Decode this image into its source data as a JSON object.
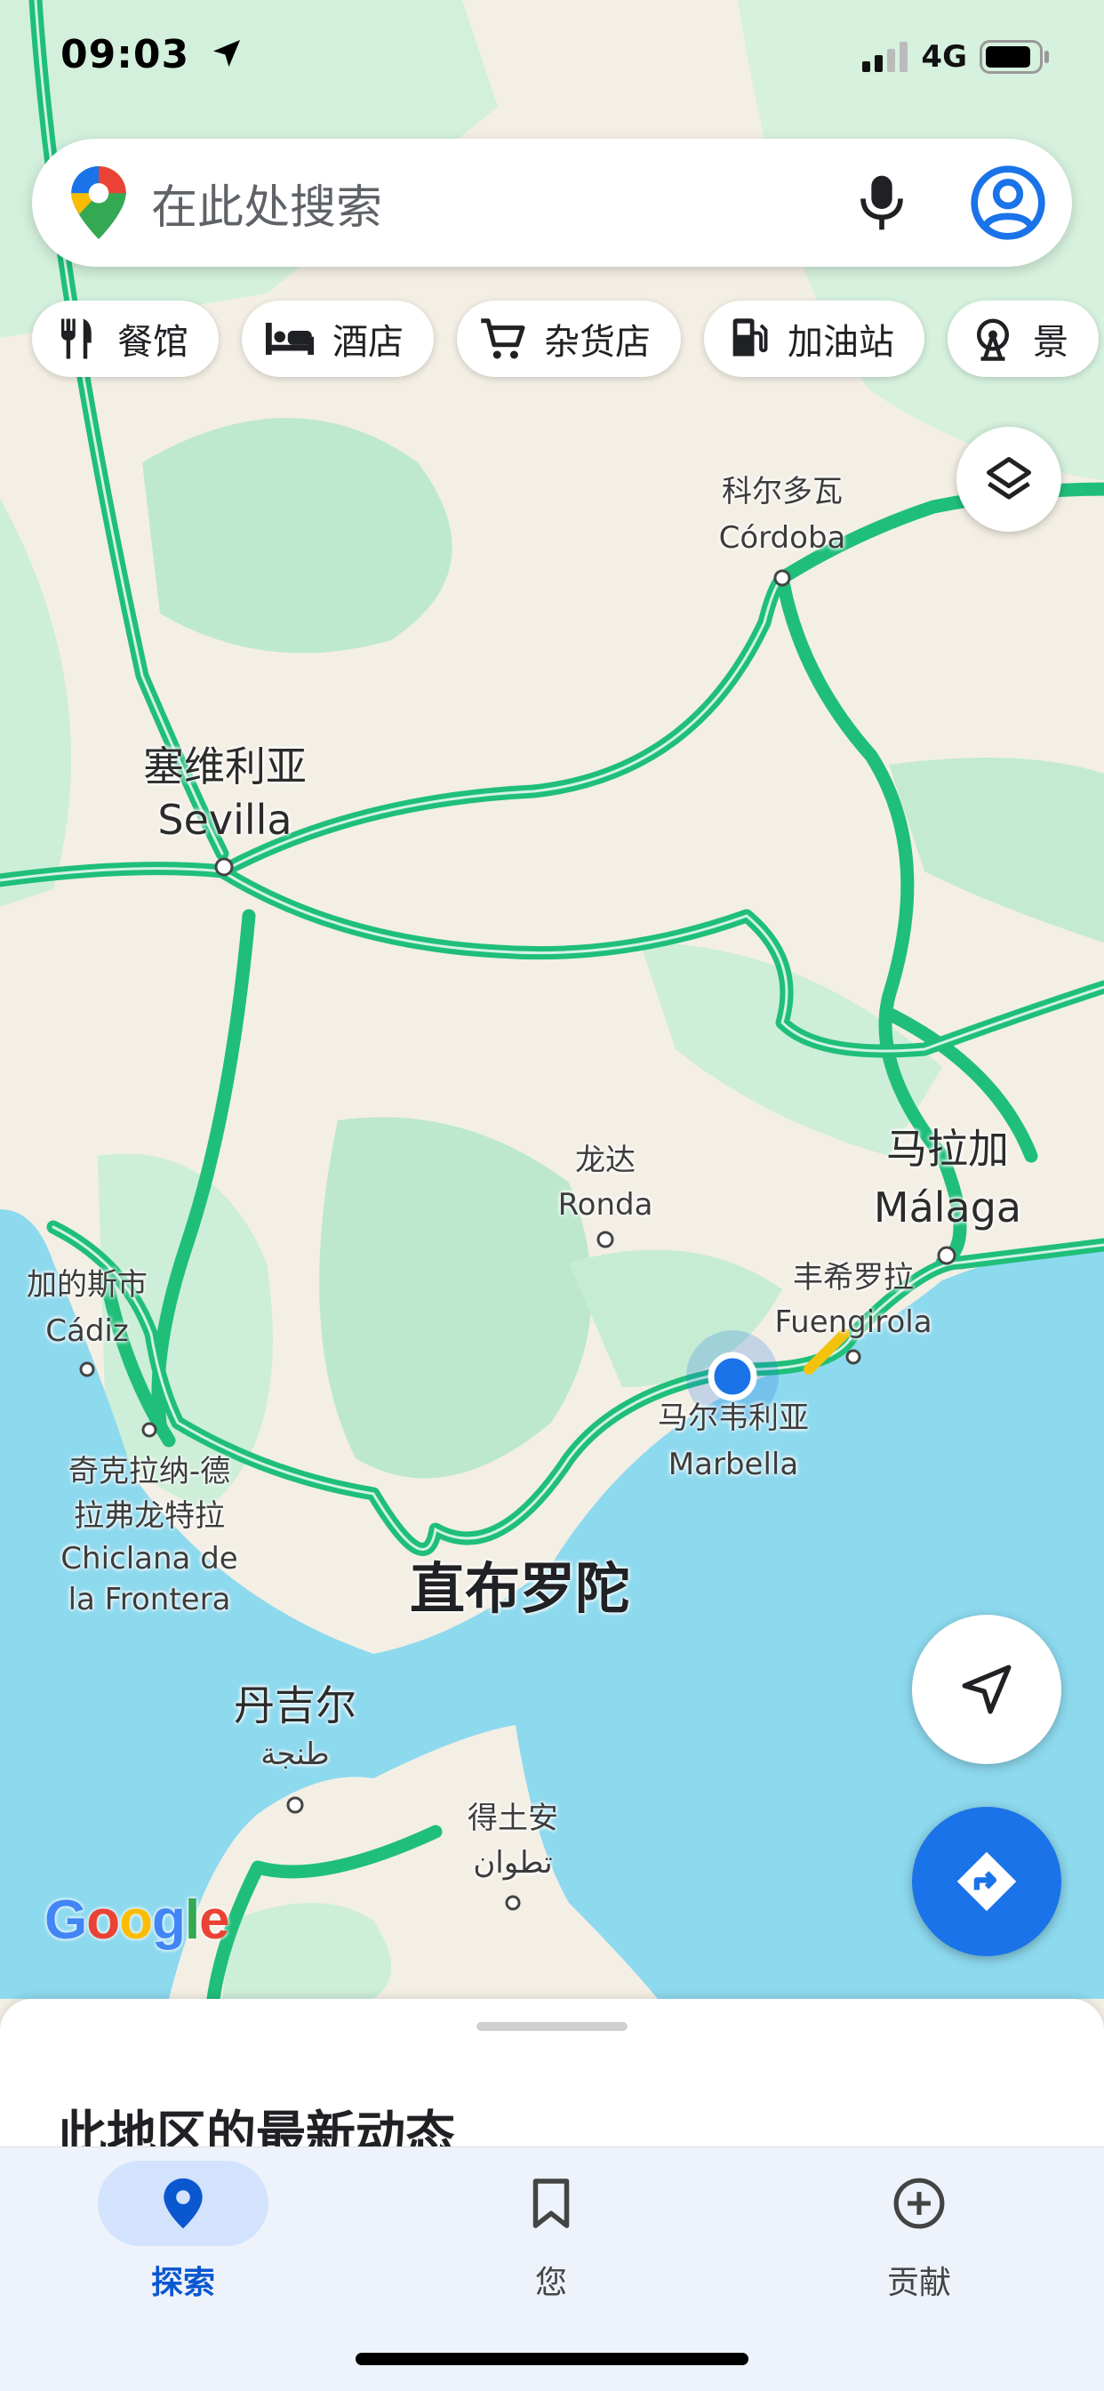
{
  "status_bar": {
    "time": "09:03",
    "network": "4G"
  },
  "search": {
    "placeholder": "在此处搜索"
  },
  "chips": [
    {
      "label": "餐馆",
      "icon": "restaurant-icon"
    },
    {
      "label": "酒店",
      "icon": "hotel-icon"
    },
    {
      "label": "杂货店",
      "icon": "cart-icon"
    },
    {
      "label": "加油站",
      "icon": "gas-icon"
    },
    {
      "label": "景",
      "icon": "attraction-icon"
    }
  ],
  "map": {
    "places": [
      {
        "zh": "科尔多瓦",
        "en": "Córdoba"
      },
      {
        "zh": "塞维利亚",
        "en": "Sevilla"
      },
      {
        "zh": "龙达",
        "en": "Ronda"
      },
      {
        "zh": "马拉加",
        "en": "Málaga"
      },
      {
        "zh": "丰希罗拉",
        "en": "Fuengirola"
      },
      {
        "zh": "马尔韦利亚",
        "en": "Marbella"
      },
      {
        "zh": "加的斯市",
        "en": "Cádiz"
      },
      {
        "zh": "奇克拉纳-德",
        "zh2": "拉弗龙特拉",
        "en": "Chiclana de",
        "en2": "la Frontera"
      },
      {
        "zh": "丹吉尔",
        "ar": "طنجة"
      },
      {
        "zh": "得土安",
        "ar": "تطوان"
      }
    ],
    "sea_label": "直布罗陀",
    "brand": "Google",
    "colors": {
      "road": "#2fd08a",
      "water": "#8dd9ee",
      "land": "#f3efe5",
      "park": "#c6ecd4",
      "location": "#1a73e8"
    }
  },
  "sheet": {
    "title": "此地区的最新动态"
  },
  "nav": [
    {
      "label": "探索",
      "icon": "explore-pin-icon",
      "active": true
    },
    {
      "label": "您",
      "icon": "bookmark-icon",
      "active": false
    },
    {
      "label": "贡献",
      "icon": "add-circle-icon",
      "active": false
    }
  ]
}
